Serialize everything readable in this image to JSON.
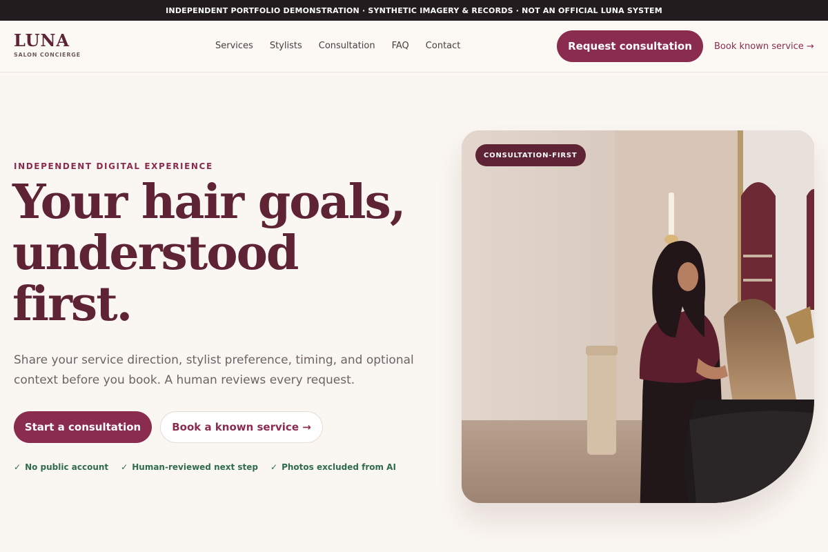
{
  "banner": {
    "text": "INDEPENDENT PORTFOLIO DEMONSTRATION · SYNTHETIC IMAGERY & RECORDS · NOT AN OFFICIAL LUNA SYSTEM"
  },
  "header": {
    "logo_word": "LUNA",
    "logo_sub": "SALON CONCIERGE",
    "nav": [
      "Services",
      "Stylists",
      "Consultation",
      "FAQ",
      "Contact"
    ],
    "cta_label": "Request consultation",
    "link_label": "Book known service →"
  },
  "hero": {
    "eyebrow": "INDEPENDENT DIGITAL EXPERIENCE",
    "headline_1": "Your hair goals,",
    "headline_2": "understood",
    "headline_3": "first.",
    "lede": "Share your service direction, stylist preference, timing, and optional context before you book. A human reviews every request.",
    "primary_label": "Start a consultation",
    "secondary_label": "Book a known service →",
    "checks": [
      "No public account",
      "Human-reviewed next step",
      "Photos excluded from AI"
    ],
    "check_mark": "✓",
    "badge": "CONSULTATION-FIRST"
  },
  "colors": {
    "brand": "#8a2c4e",
    "brand_dark": "#5e2334",
    "banner_bg": "#231c1e",
    "check_green": "#2f6b4c",
    "page_bg": "#faf6f1"
  }
}
